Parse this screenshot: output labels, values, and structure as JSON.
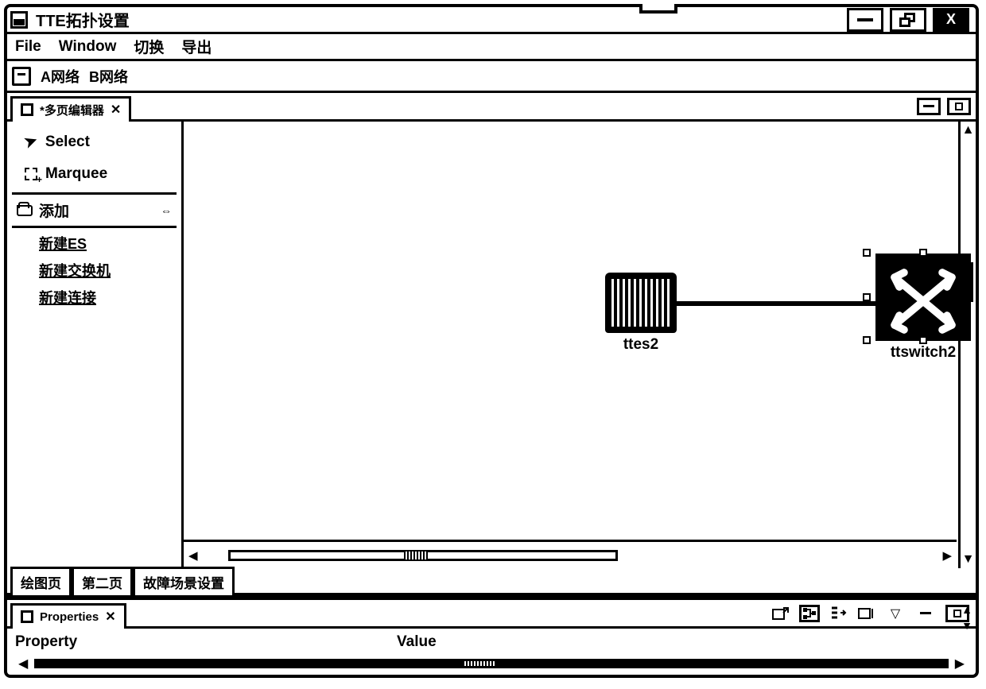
{
  "window": {
    "title": "TTE拓扑设置"
  },
  "menubar": {
    "file": "File",
    "window": "Window",
    "switch": "切换",
    "export": "导出"
  },
  "toolbar": {
    "network_a": "A网络",
    "network_b": "B网络"
  },
  "editor": {
    "tab_label": "*多页编辑器",
    "palette": {
      "select": "Select",
      "marquee": "Marquee",
      "add_folder": "添加",
      "new_es": "新建ES",
      "new_switch": "新建交换机",
      "new_link": "新建连接"
    },
    "nodes": {
      "ttes2_label": "ttes2",
      "ttswitch2_label": "ttswitch2"
    }
  },
  "page_tabs": {
    "draw_page": "绘图页",
    "page2": "第二页",
    "fault_scene": "故障场景设置"
  },
  "properties": {
    "title": "Properties",
    "col_property": "Property",
    "col_value": "Value"
  }
}
